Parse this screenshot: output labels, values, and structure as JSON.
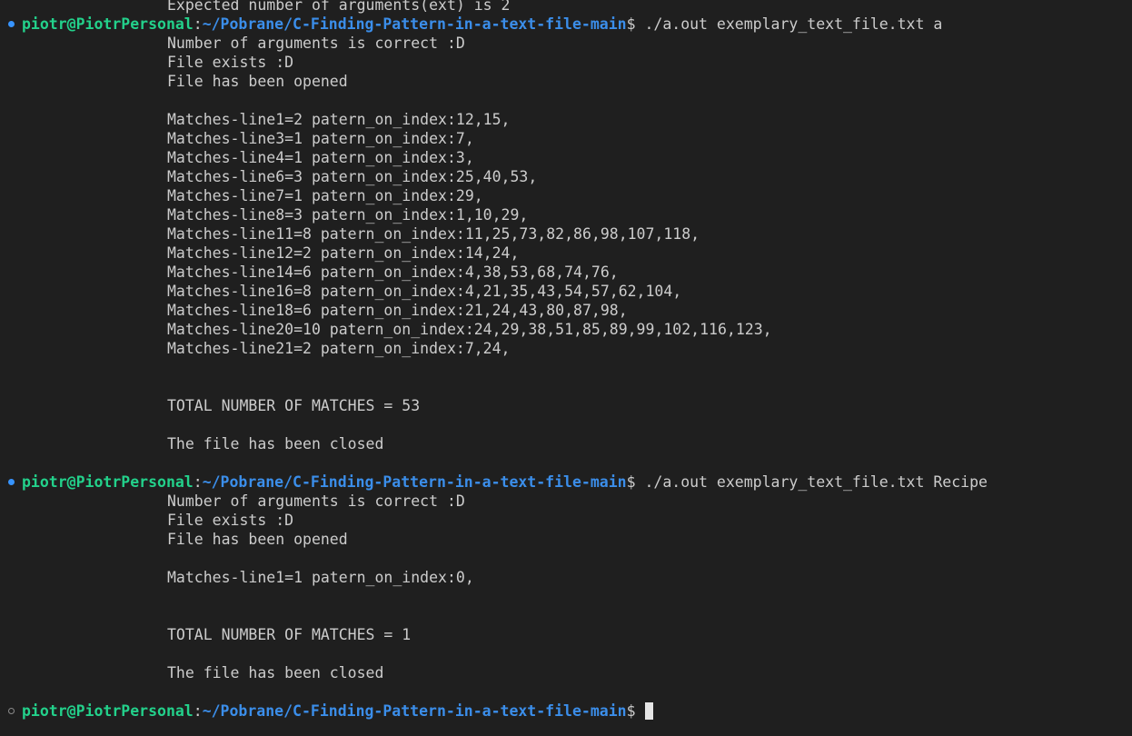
{
  "prompt": {
    "user_host": "piotr@PiotrPersonal",
    "colon": ":",
    "path": "~/Pobrane/C-Finding-Pattern-in-a-text-file-main",
    "dollar": "$ "
  },
  "scrolled_top_line": "Expected number of arguments(ext) is 2",
  "runs": [
    {
      "command": "./a.out exemplary_text_file.txt a",
      "lines": [
        "Number of arguments is correct :D",
        "File exists :D",
        "File has been opened",
        "",
        "Matches-line1=2 patern_on_index:12,15,",
        "Matches-line3=1 patern_on_index:7,",
        "Matches-line4=1 patern_on_index:3,",
        "Matches-line6=3 patern_on_index:25,40,53,",
        "Matches-line7=1 patern_on_index:29,",
        "Matches-line8=3 patern_on_index:1,10,29,",
        "Matches-line11=8 patern_on_index:11,25,73,82,86,98,107,118,",
        "Matches-line12=2 patern_on_index:14,24,",
        "Matches-line14=6 patern_on_index:4,38,53,68,74,76,",
        "Matches-line16=8 patern_on_index:4,21,35,43,54,57,62,104,",
        "Matches-line18=6 patern_on_index:21,24,43,80,87,98,",
        "Matches-line20=10 patern_on_index:24,29,38,51,85,89,99,102,116,123,",
        "Matches-line21=2 patern_on_index:7,24,",
        "",
        "",
        "TOTAL NUMBER OF MATCHES = 53",
        "",
        "The file has been closed",
        ""
      ]
    },
    {
      "command": "./a.out exemplary_text_file.txt Recipe",
      "lines": [
        "Number of arguments is correct :D",
        "File exists :D",
        "File has been opened",
        "",
        "Matches-line1=1 patern_on_index:0,",
        "",
        "",
        "TOTAL NUMBER OF MATCHES = 1",
        "",
        "The file has been closed",
        ""
      ]
    }
  ],
  "current_command": ""
}
